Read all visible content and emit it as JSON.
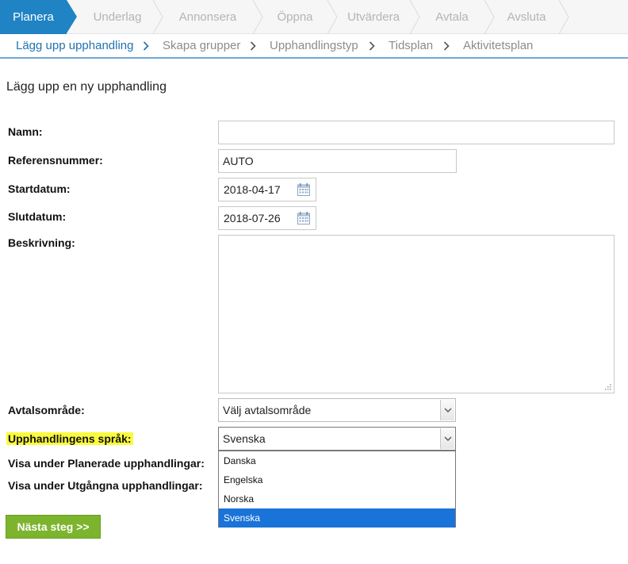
{
  "steps": {
    "items": [
      {
        "label": "Planera",
        "active": true
      },
      {
        "label": "Underlag",
        "active": false
      },
      {
        "label": "Annonsera",
        "active": false
      },
      {
        "label": "Öppna",
        "active": false
      },
      {
        "label": "Utvärdera",
        "active": false
      },
      {
        "label": "Avtala",
        "active": false
      },
      {
        "label": "Avsluta",
        "active": false
      }
    ],
    "active_color": "#1f83c4"
  },
  "substeps": {
    "items": [
      {
        "label": "Lägg upp upphandling",
        "active": true
      },
      {
        "label": "Skapa grupper",
        "active": false
      },
      {
        "label": "Upphandlingstyp",
        "active": false
      },
      {
        "label": "Tidsplan",
        "active": false
      },
      {
        "label": "Aktivitetsplan",
        "active": false
      }
    ]
  },
  "page": {
    "heading": "Lägg upp en ny upphandling"
  },
  "form": {
    "name": {
      "label": "Namn:",
      "value": ""
    },
    "reference": {
      "label": "Referensnummer:",
      "value": "AUTO"
    },
    "start_date": {
      "label": "Startdatum:",
      "value": "2018-04-17",
      "icon": "calendar-icon"
    },
    "end_date": {
      "label": "Slutdatum:",
      "value": "2018-07-26",
      "icon": "calendar-icon"
    },
    "description": {
      "label": "Beskrivning:",
      "value": ""
    },
    "agreement_area": {
      "label": "Avtalsområde:",
      "value": "Välj avtalsområde"
    },
    "language": {
      "label": "Upphandlingens språk:",
      "value": "Svenska",
      "highlight_color": "#fbfb3d",
      "options": [
        "Danska",
        "Engelska",
        "Norska",
        "Svenska"
      ],
      "selected": "Svenska"
    },
    "show_planned": {
      "label": "Visa under Planerade upphandlingar:"
    },
    "show_expired": {
      "label": "Visa under Utgångna upphandlingar:"
    }
  },
  "actions": {
    "next_label": "Nästa steg >>",
    "next_color": "#7cb42e"
  }
}
